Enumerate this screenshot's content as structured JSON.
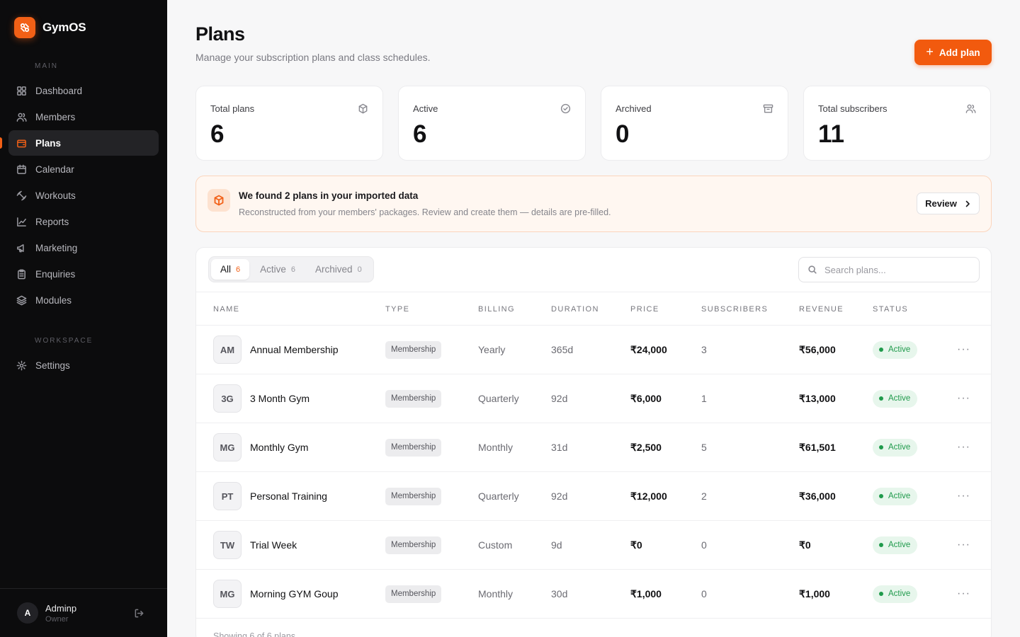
{
  "brand": {
    "name": "GymOS"
  },
  "sidebar": {
    "main_label": "MAIN",
    "workspace_label": "WORKSPACE",
    "items": [
      {
        "label": "Dashboard",
        "icon": "dashboard-icon",
        "active": false
      },
      {
        "label": "Members",
        "icon": "users-icon",
        "active": false
      },
      {
        "label": "Plans",
        "icon": "wallet-icon",
        "active": true
      },
      {
        "label": "Calendar",
        "icon": "calendar-icon",
        "active": false
      },
      {
        "label": "Workouts",
        "icon": "dumbbell-icon",
        "active": false
      },
      {
        "label": "Reports",
        "icon": "chart-line-icon",
        "active": false
      },
      {
        "label": "Marketing",
        "icon": "megaphone-icon",
        "active": false
      },
      {
        "label": "Enquiries",
        "icon": "clipboard-icon",
        "active": false
      },
      {
        "label": "Modules",
        "icon": "layers-icon",
        "active": false
      }
    ],
    "workspace_items": [
      {
        "label": "Settings",
        "icon": "gear-icon"
      }
    ],
    "user": {
      "initial": "A",
      "name": "Adminp",
      "role": "Owner"
    }
  },
  "header": {
    "title": "Plans",
    "subtitle": "Manage your subscription plans and class schedules.",
    "add_button": "Add plan"
  },
  "stats": [
    {
      "label": "Total plans",
      "value": "6",
      "icon": "box-icon"
    },
    {
      "label": "Active",
      "value": "6",
      "icon": "check-circle-icon"
    },
    {
      "label": "Archived",
      "value": "0",
      "icon": "archive-icon"
    },
    {
      "label": "Total subscribers",
      "value": "11",
      "icon": "users-icon"
    }
  ],
  "banner": {
    "title": "We found 2 plans in your imported data",
    "subtitle": "Reconstructed from your members' packages. Review and create them — details are pre-filled.",
    "button": "Review"
  },
  "tabs": [
    {
      "label": "All",
      "count": "6",
      "active": true
    },
    {
      "label": "Active",
      "count": "6",
      "active": false
    },
    {
      "label": "Archived",
      "count": "0",
      "active": false
    }
  ],
  "search": {
    "placeholder": "Search plans..."
  },
  "table": {
    "headers": [
      "NAME",
      "TYPE",
      "BILLING",
      "DURATION",
      "PRICE",
      "SUBSCRIBERS",
      "REVENUE",
      "STATUS"
    ],
    "rows": [
      {
        "initials": "AM",
        "name": "Annual Membership",
        "type": "Membership",
        "billing": "Yearly",
        "duration": "365d",
        "price": "₹24,000",
        "subscribers": "3",
        "revenue": "₹56,000",
        "status": "Active"
      },
      {
        "initials": "3G",
        "name": "3 Month Gym",
        "type": "Membership",
        "billing": "Quarterly",
        "duration": "92d",
        "price": "₹6,000",
        "subscribers": "1",
        "revenue": "₹13,000",
        "status": "Active"
      },
      {
        "initials": "MG",
        "name": "Monthly Gym",
        "type": "Membership",
        "billing": "Monthly",
        "duration": "31d",
        "price": "₹2,500",
        "subscribers": "5",
        "revenue": "₹61,501",
        "status": "Active"
      },
      {
        "initials": "PT",
        "name": "Personal Training",
        "type": "Membership",
        "billing": "Quarterly",
        "duration": "92d",
        "price": "₹12,000",
        "subscribers": "2",
        "revenue": "₹36,000",
        "status": "Active"
      },
      {
        "initials": "TW",
        "name": "Trial Week",
        "type": "Membership",
        "billing": "Custom",
        "duration": "9d",
        "price": "₹0",
        "subscribers": "0",
        "revenue": "₹0",
        "status": "Active"
      },
      {
        "initials": "MG",
        "name": "Morning GYM Goup",
        "type": "Membership",
        "billing": "Monthly",
        "duration": "30d",
        "price": "₹1,000",
        "subscribers": "0",
        "revenue": "₹1,000",
        "status": "Active"
      }
    ],
    "footer": "Showing 6 of 6 plans"
  },
  "colors": {
    "accent": "#f25a0e",
    "sidebar_bg": "#0c0c0d",
    "success": "#1f9a4b"
  }
}
